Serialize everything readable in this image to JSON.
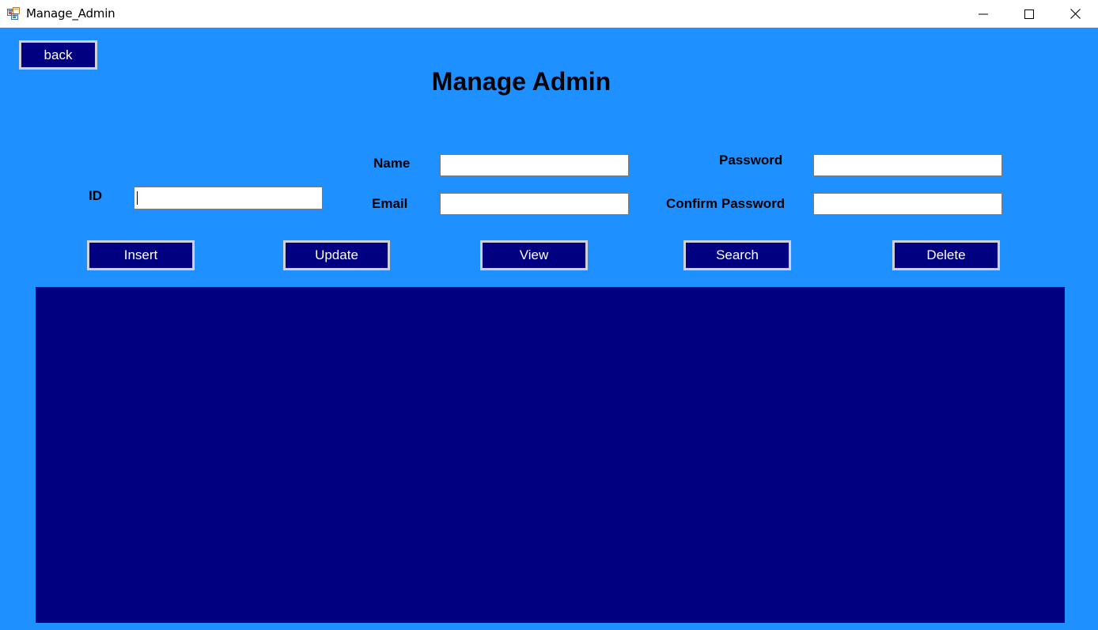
{
  "window": {
    "title": "Manage_Admin",
    "icon": "form-app-icon",
    "controls": {
      "minimize_icon": "minimize-icon",
      "maximize_icon": "maximize-icon",
      "close_icon": "close-icon"
    }
  },
  "colors": {
    "form_background": "#1e90ff",
    "button_background": "#000080",
    "button_text": "#ffffff",
    "grid_background": "#000080"
  },
  "nav": {
    "back_label": "back"
  },
  "heading": "Manage Admin",
  "form": {
    "id_label": "ID",
    "id_value": "",
    "name_label": "Name",
    "name_value": "",
    "email_label": "Email",
    "email_value": "",
    "password_label": "Password",
    "password_value": "",
    "confirm_password_label": "Confirm Password",
    "confirm_password_value": ""
  },
  "actions": {
    "insert_label": "Insert",
    "update_label": "Update",
    "view_label": "View",
    "search_label": "Search",
    "delete_label": "Delete"
  }
}
